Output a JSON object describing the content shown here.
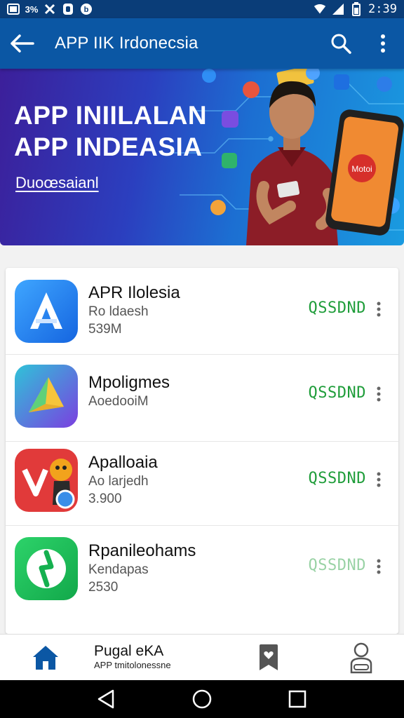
{
  "status_bar": {
    "time": "2:39",
    "left_icons": [
      "photo-icon",
      "3g-icon",
      "puzzle-icon",
      "shield-icon",
      "b-icon"
    ],
    "right_icons": [
      "wifi-icon",
      "signal-icon",
      "battery-icon"
    ]
  },
  "app_bar": {
    "title": "APP IIK Irdonecsia",
    "back_icon": "arrow-left-icon",
    "search_icon": "search-icon",
    "menu_icon": "more-vert-icon"
  },
  "banner": {
    "title_line1": "APP INIILALAN",
    "title_line2": "APP INDEASIA",
    "link": "Duoœsaianl",
    "phone_badge": "Motoi"
  },
  "apps": [
    {
      "name": "APR Ilolesia",
      "subtitle": "Ro ldaesh",
      "meta": "539M",
      "action": "QSSDND",
      "icon": "a-app-icon"
    },
    {
      "name": "Mpoligmes",
      "subtitle": "AoedooiM",
      "meta": "",
      "action": "QSSDND",
      "icon": "play-triangle-icon"
    },
    {
      "name": "Apalloaia",
      "subtitle": "Ao larjedh",
      "meta": "3.900",
      "action": "QSSDND",
      "icon": "mascot-app-icon"
    },
    {
      "name": "Rpanileohams",
      "subtitle": "Kendapas",
      "meta": "2530",
      "action": "QSSDND",
      "icon": "green-leaf-app-icon"
    }
  ],
  "bottom_nav": {
    "title": "Pugal eKA",
    "subtitle": "APP tmitolonessne",
    "icons": [
      "home-icon",
      "bookmark-heart-icon",
      "profile-icon"
    ]
  },
  "colors": {
    "primary": "#0b57a4",
    "status": "#0a3d78",
    "install_green": "#1f9d3a",
    "home_active": "#0b57a4"
  }
}
